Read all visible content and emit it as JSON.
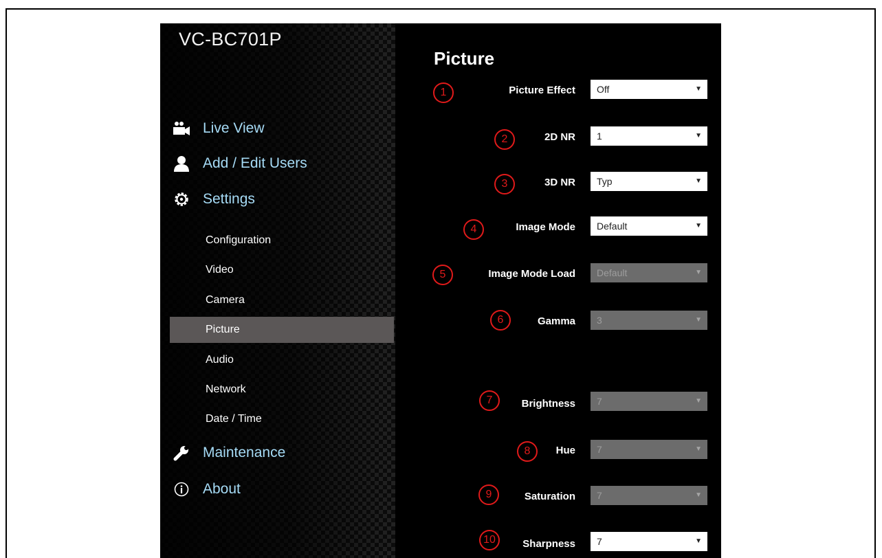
{
  "brand": "VC-BC701P",
  "nav": {
    "live_view": "Live View",
    "add_edit_users": "Add / Edit Users",
    "settings": "Settings",
    "maintenance": "Maintenance",
    "about": "About"
  },
  "settings_sub": [
    "Configuration",
    "Video",
    "Camera",
    "Picture",
    "Audio",
    "Network",
    "Date / Time"
  ],
  "active_sub": "Picture",
  "page_title": "Picture",
  "fields": [
    {
      "badge": "1",
      "label": "Picture Effect",
      "value": "Off",
      "enabled": true
    },
    {
      "badge": "2",
      "label": "2D NR",
      "value": "1",
      "enabled": true
    },
    {
      "badge": "3",
      "label": "3D NR",
      "value": "Typ",
      "enabled": true
    },
    {
      "badge": "4",
      "label": "Image Mode",
      "value": "Default",
      "enabled": true
    },
    {
      "badge": "5",
      "label": "Image Mode Load",
      "value": "Default",
      "enabled": false
    },
    {
      "badge": "6",
      "label": "Gamma",
      "value": "3",
      "enabled": false
    },
    {
      "badge": "7",
      "label": "Brightness",
      "value": "7",
      "enabled": false
    },
    {
      "badge": "8",
      "label": "Hue",
      "value": "7",
      "enabled": false
    },
    {
      "badge": "9",
      "label": "Saturation",
      "value": "7",
      "enabled": false
    },
    {
      "badge": "10",
      "label": "Sharpness",
      "value": "7",
      "enabled": true
    }
  ],
  "colors": {
    "nav_main": "#a6dbf6",
    "active_bg": "#5b5757",
    "badge": "#e01a1a",
    "disabled_select": "#6c6c6c"
  },
  "icons": {
    "live_view": "video-camera-icon",
    "add_edit_users": "user-icon",
    "settings": "gear-icon",
    "maintenance": "wrench-icon",
    "about": "info-icon",
    "dropdown": "caret-down-icon"
  }
}
